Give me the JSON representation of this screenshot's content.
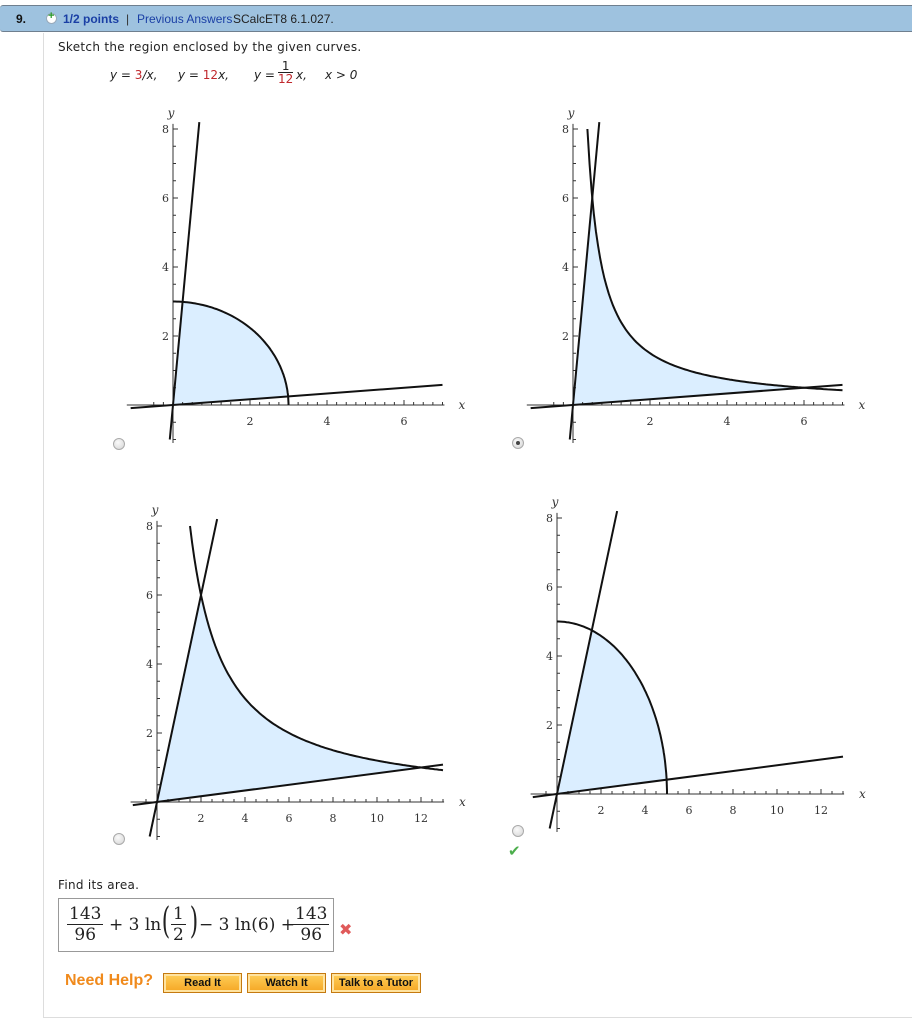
{
  "question": {
    "number": "9.",
    "points": "1/2 points",
    "separator": "|",
    "previous_answers": "Previous Answers",
    "source": "SCalcET8 6.1.027."
  },
  "prompt": "Sketch the region enclosed by the given curves.",
  "equations": {
    "eq1_prefix": "y = ",
    "eq1_red": "3",
    "eq1_suffix": "/x,",
    "eq2_prefix": "y = ",
    "eq2_red": "12",
    "eq2_suffix": "x,",
    "eq3_prefix": "y = ",
    "eq3_num": "1",
    "eq3_den": "12",
    "eq3_suffix": "x,",
    "eq4": "x > 0"
  },
  "choices": [
    {
      "id": "choice-1",
      "selected": false,
      "correct_mark": false
    },
    {
      "id": "choice-2",
      "selected": true,
      "correct_mark": false
    },
    {
      "id": "choice-3",
      "selected": false,
      "correct_mark": false
    },
    {
      "id": "choice-4",
      "selected": false,
      "correct_mark": true
    }
  ],
  "chart_data": [
    {
      "type": "line",
      "title": "",
      "xlabel": "x",
      "ylabel": "y",
      "xlim": [
        -1,
        7
      ],
      "ylim": [
        -1,
        8
      ],
      "xticks": [
        "2",
        "4",
        "6"
      ],
      "yticks": [
        "2",
        "4",
        "6",
        "8"
      ],
      "series": [
        {
          "name": "y = 12x",
          "fn": "12x"
        },
        {
          "name": "y = x/12",
          "fn": "x/12"
        },
        {
          "name": "circle radius 3",
          "fn": "sqrt(9-x^2)"
        }
      ],
      "shaded_region": "between y=12x, y=x/12 and circle r=3"
    },
    {
      "type": "line",
      "title": "",
      "xlabel": "x",
      "ylabel": "y",
      "xlim": [
        -1,
        7
      ],
      "ylim": [
        -1,
        8
      ],
      "xticks": [
        "2",
        "4",
        "6"
      ],
      "yticks": [
        "2",
        "4",
        "6",
        "8"
      ],
      "series": [
        {
          "name": "y = 12x",
          "fn": "12x"
        },
        {
          "name": "y = x/12",
          "fn": "x/12"
        },
        {
          "name": "y = 3/x",
          "fn": "3/x"
        }
      ],
      "intersections": [
        [
          0.5,
          6
        ],
        [
          6,
          0.5
        ]
      ],
      "shaded_region": "between y=12x, y=x/12 and y=3/x"
    },
    {
      "type": "line",
      "title": "",
      "xlabel": "x",
      "ylabel": "y",
      "xlim": [
        -1,
        13
      ],
      "ylim": [
        -1,
        8
      ],
      "xticks": [
        "2",
        "4",
        "6",
        "8",
        "10",
        "12"
      ],
      "yticks": [
        "2",
        "4",
        "6",
        "8"
      ],
      "series": [
        {
          "name": "y = 3x",
          "fn": "3x"
        },
        {
          "name": "y = x/12",
          "fn": "x/12"
        },
        {
          "name": "y = 12/x",
          "fn": "12/x"
        }
      ],
      "intersections": [
        [
          2,
          6
        ],
        [
          12,
          1
        ]
      ],
      "shaded_region": "between y=3x, y=x/12 and y=12/x"
    },
    {
      "type": "line",
      "title": "",
      "xlabel": "x",
      "ylabel": "y",
      "xlim": [
        -1,
        13
      ],
      "ylim": [
        -1,
        8
      ],
      "xticks": [
        "2",
        "4",
        "6",
        "8",
        "10",
        "12"
      ],
      "yticks": [
        "2",
        "4",
        "6",
        "8"
      ],
      "series": [
        {
          "name": "y = 3x",
          "fn": "3x"
        },
        {
          "name": "y = x/12",
          "fn": "x/12"
        },
        {
          "name": "circle radius 5",
          "fn": "sqrt(25-x^2)"
        }
      ],
      "shaded_region": "between y=3x, y=x/12 and circle r=5"
    }
  ],
  "find_area": "Find its area.",
  "answer": {
    "frac1_num": "143",
    "frac1_den": "96",
    "term2": "+ 3 ln",
    "half_num": "1",
    "half_den": "2",
    "term3": "− 3 ln(6) +",
    "frac2_num": "143",
    "frac2_den": "96",
    "status": "incorrect"
  },
  "help": {
    "label": "Need Help?",
    "buttons": [
      "Read It",
      "Watch It",
      "Talk to a Tutor"
    ]
  },
  "icons": {
    "plus": "plus-circle-icon",
    "wrong": "x-mark-icon",
    "correct": "check-mark-icon"
  }
}
